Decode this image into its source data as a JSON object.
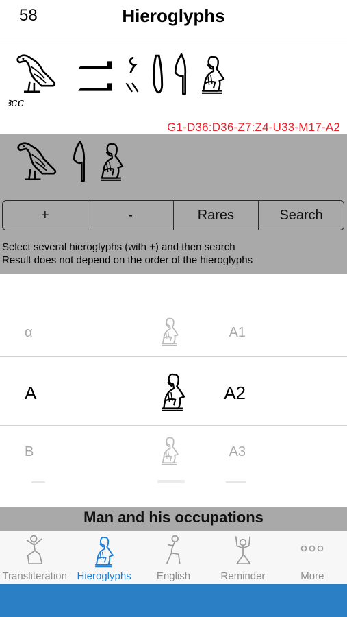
{
  "header": {
    "count": "58",
    "title": "Hieroglyphs"
  },
  "word": {
    "transliteration": "ꜣcc",
    "gardiner_code": "G1-D36:D36-Z7:Z4-U33-M17-A2",
    "glyph_names": [
      "vulture-glyph",
      "arm-glyph",
      "arm-glyph",
      "quail-chick-glyph",
      "dual-strokes-glyph",
      "pestle-glyph",
      "reed-leaf-glyph",
      "man-hand-to-mouth-glyph"
    ]
  },
  "selection": {
    "glyph_names": [
      "vulture-glyph",
      "reed-leaf-glyph",
      "man-hand-to-mouth-glyph"
    ]
  },
  "buttons": {
    "plus": "+",
    "minus": "-",
    "rares": "Rares",
    "search": "Search"
  },
  "instructions": {
    "line1": "Select several hieroglyphs (with +) and then search",
    "line2": "Result does not depend on the order of the hieroglyphs"
  },
  "picker": {
    "rows": [
      {
        "letter": "α",
        "code": "A1"
      },
      {
        "letter": "A",
        "code": "A2",
        "selected": true
      },
      {
        "letter": "B",
        "code": "A3"
      }
    ]
  },
  "category": "Man and his occupations",
  "tabs": [
    {
      "label": "Transliteration",
      "icon": "man-kneeling-icon",
      "active": false
    },
    {
      "label": "Hieroglyphs",
      "icon": "man-hand-to-mouth-icon",
      "active": true
    },
    {
      "label": "English",
      "icon": "man-seated-icon",
      "active": false
    },
    {
      "label": "Reminder",
      "icon": "man-arms-raised-icon",
      "active": false
    },
    {
      "label": "More",
      "icon": "more-dots-icon",
      "active": false
    }
  ],
  "colors": {
    "accent": "#1f7ed8",
    "code_red": "#e8202a",
    "panel_gray": "#a9a9a9",
    "bottom_bar": "#2b7fc4"
  }
}
